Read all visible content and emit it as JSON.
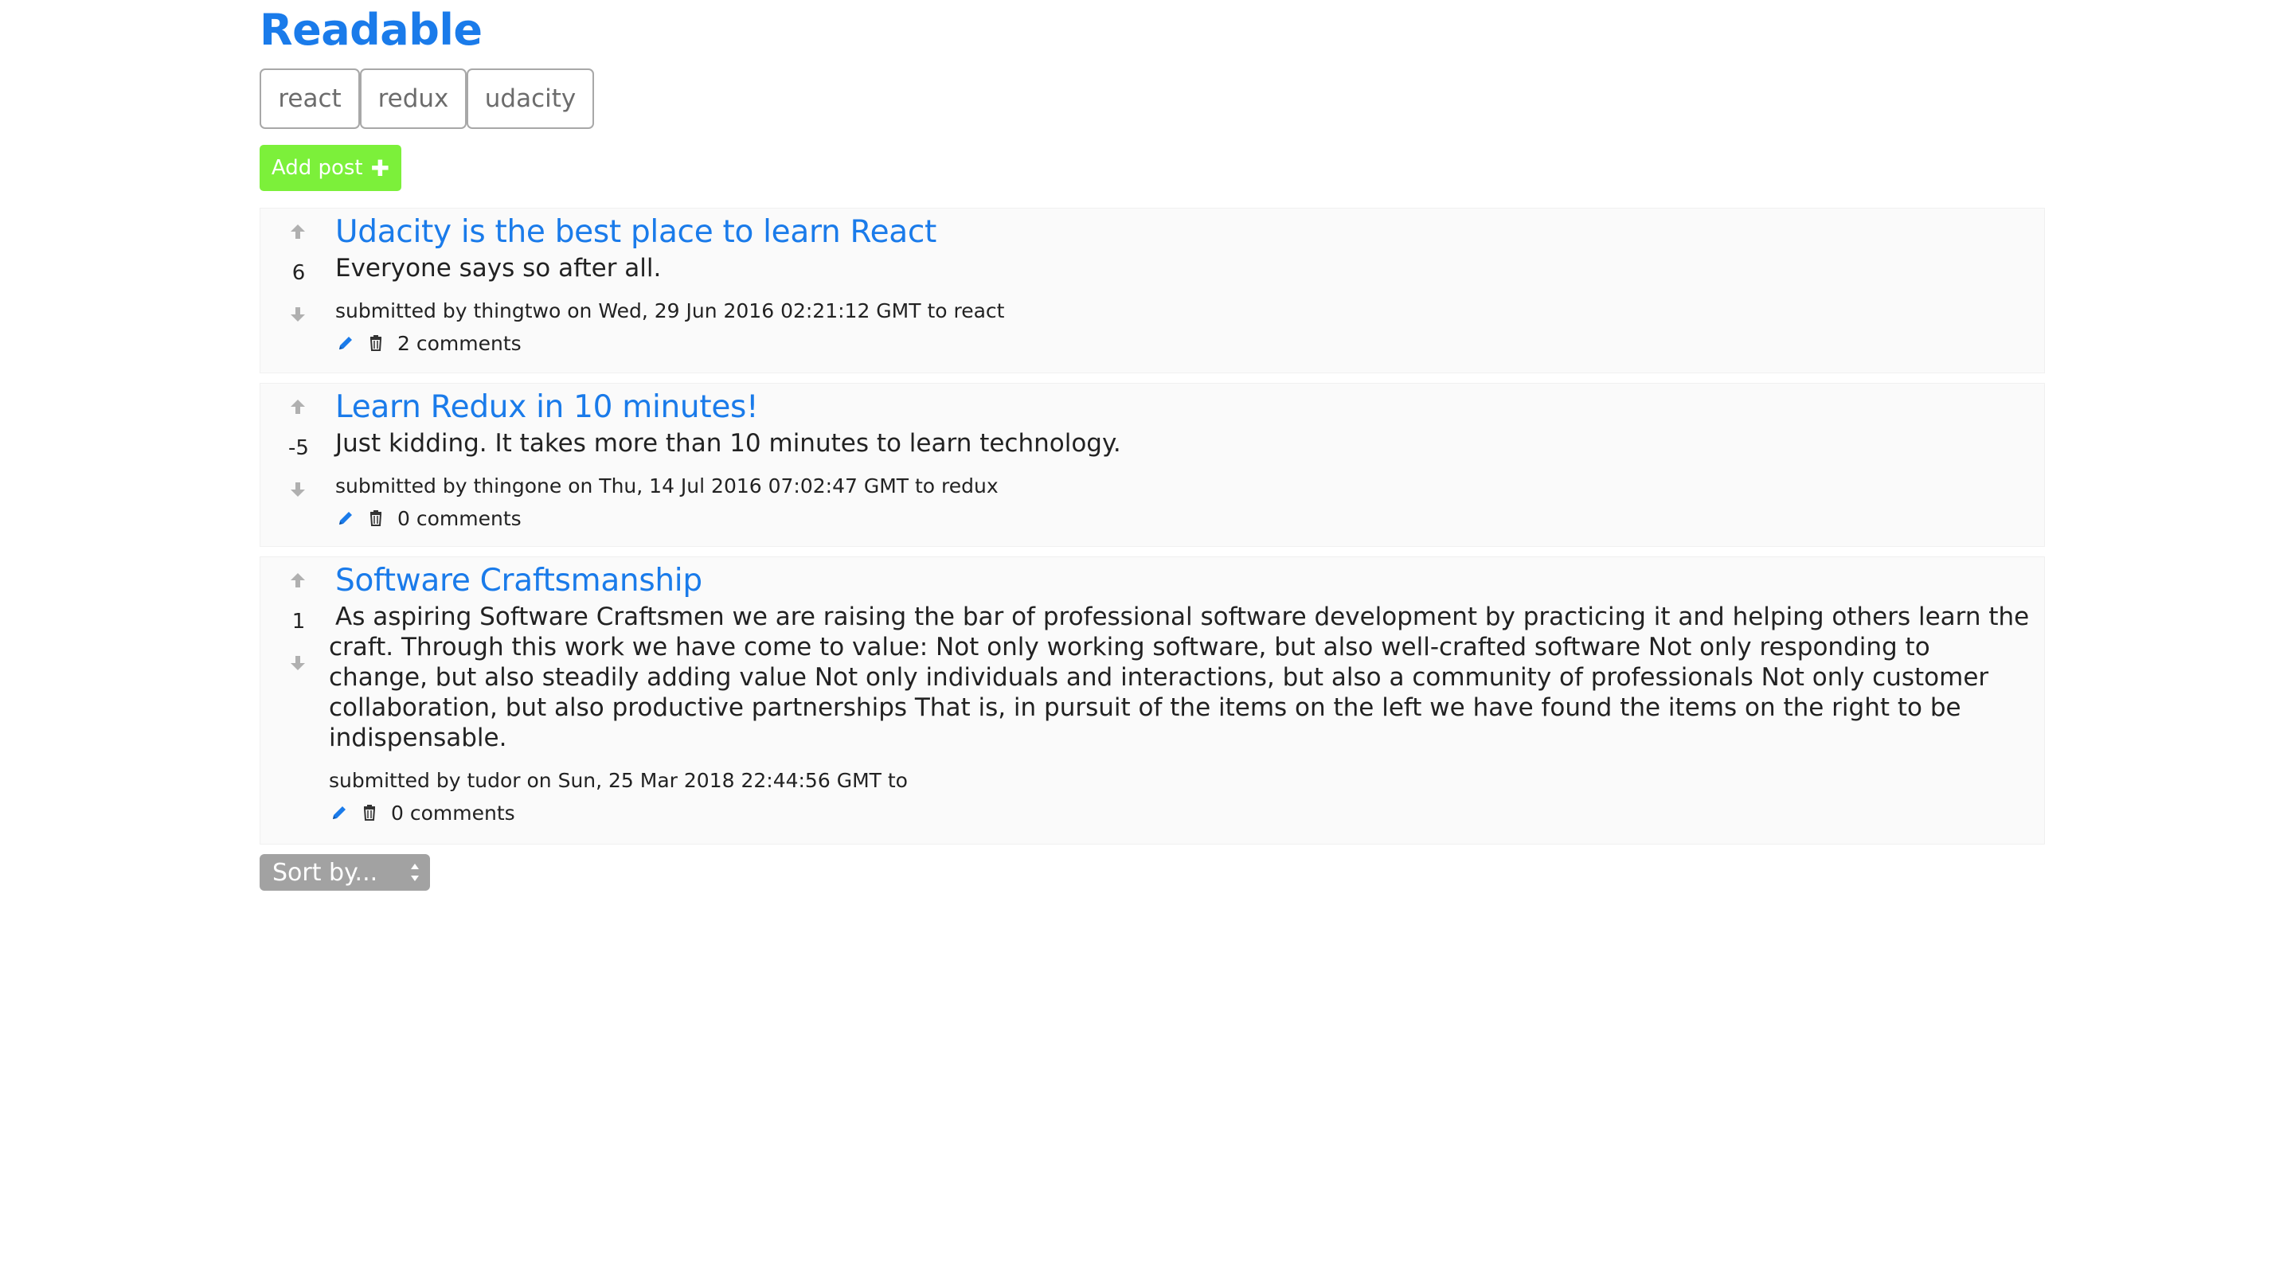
{
  "app": {
    "title": "Readable"
  },
  "categories": [
    {
      "label": "react"
    },
    {
      "label": "redux"
    },
    {
      "label": "udacity"
    }
  ],
  "add_post": {
    "label": "Add post",
    "icon": "plus-icon"
  },
  "posts": [
    {
      "title": "Udacity is the best place to learn React",
      "body": "Everyone says so after all.",
      "score": "6",
      "meta": "submitted by thingtwo on Wed, 29 Jun 2016 02:21:12 GMT to react",
      "comments": "2 comments"
    },
    {
      "title": "Learn Redux in 10 minutes!",
      "body": "Just kidding. It takes more than 10 minutes to learn technology.",
      "score": "-5",
      "meta": "submitted by thingone on Thu, 14 Jul 2016 07:02:47 GMT to redux",
      "comments": "0 comments"
    },
    {
      "title": "Software Craftsmanship",
      "body": "As aspiring Software Craftsmen we are raising the bar of professional software development by practicing it and helping others learn the craft. Through this work we have come to value: Not only working software, but also well-crafted software Not only responding to change, but also steadily adding value Not only individuals and interactions, but also a community of professionals Not only customer collaboration, but also productive partnerships That is, in pursuit of the items on the left we have found the items on the right to be indispensable.",
      "score": "1",
      "meta": "submitted by tudor on Sun, 25 Mar 2018 22:44:56 GMT to",
      "comments": "0 comments"
    }
  ],
  "sort": {
    "selected": "Sort by..."
  },
  "colors": {
    "brand": "#1a7bea",
    "add_post_bg": "#7cf03a",
    "sort_bg": "#a2a2a2",
    "vote_arrow": "#b0b0b0",
    "card_bg": "#fafafa"
  }
}
